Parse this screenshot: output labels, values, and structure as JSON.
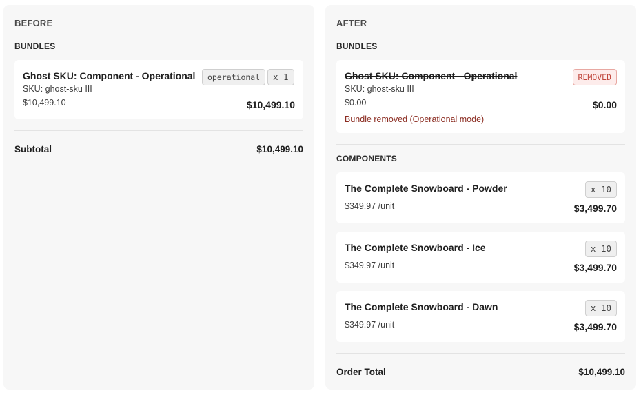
{
  "before": {
    "title": "BEFORE",
    "bundles_label": "BUNDLES",
    "bundle": {
      "name": "Ghost SKU: Component - Operational",
      "sku": "SKU: ghost-sku III",
      "unit_price": "$10,499.10",
      "mode_badge": "operational",
      "qty_badge": "x 1",
      "line_total": "$10,499.10"
    },
    "subtotal_label": "Subtotal",
    "subtotal_value": "$10,499.10"
  },
  "after": {
    "title": "AFTER",
    "bundles_label": "BUNDLES",
    "bundle": {
      "name": "Ghost SKU: Component - Operational",
      "sku": "SKU: ghost-sku III",
      "unit_price": "$0.00",
      "status_badge": "REMOVED",
      "line_total": "$0.00",
      "note": "Bundle removed (Operational mode)"
    },
    "components_label": "COMPONENTS",
    "components": [
      {
        "name": "The Complete Snowboard - Powder",
        "unit_price": "$349.97 /unit",
        "qty_badge": "x 10",
        "line_total": "$3,499.70"
      },
      {
        "name": "The Complete Snowboard - Ice",
        "unit_price": "$349.97 /unit",
        "qty_badge": "x 10",
        "line_total": "$3,499.70"
      },
      {
        "name": "The Complete Snowboard - Dawn",
        "unit_price": "$349.97 /unit",
        "qty_badge": "x 10",
        "line_total": "$3,499.70"
      }
    ],
    "total_label": "Order Total",
    "total_value": "$10,499.10"
  }
}
